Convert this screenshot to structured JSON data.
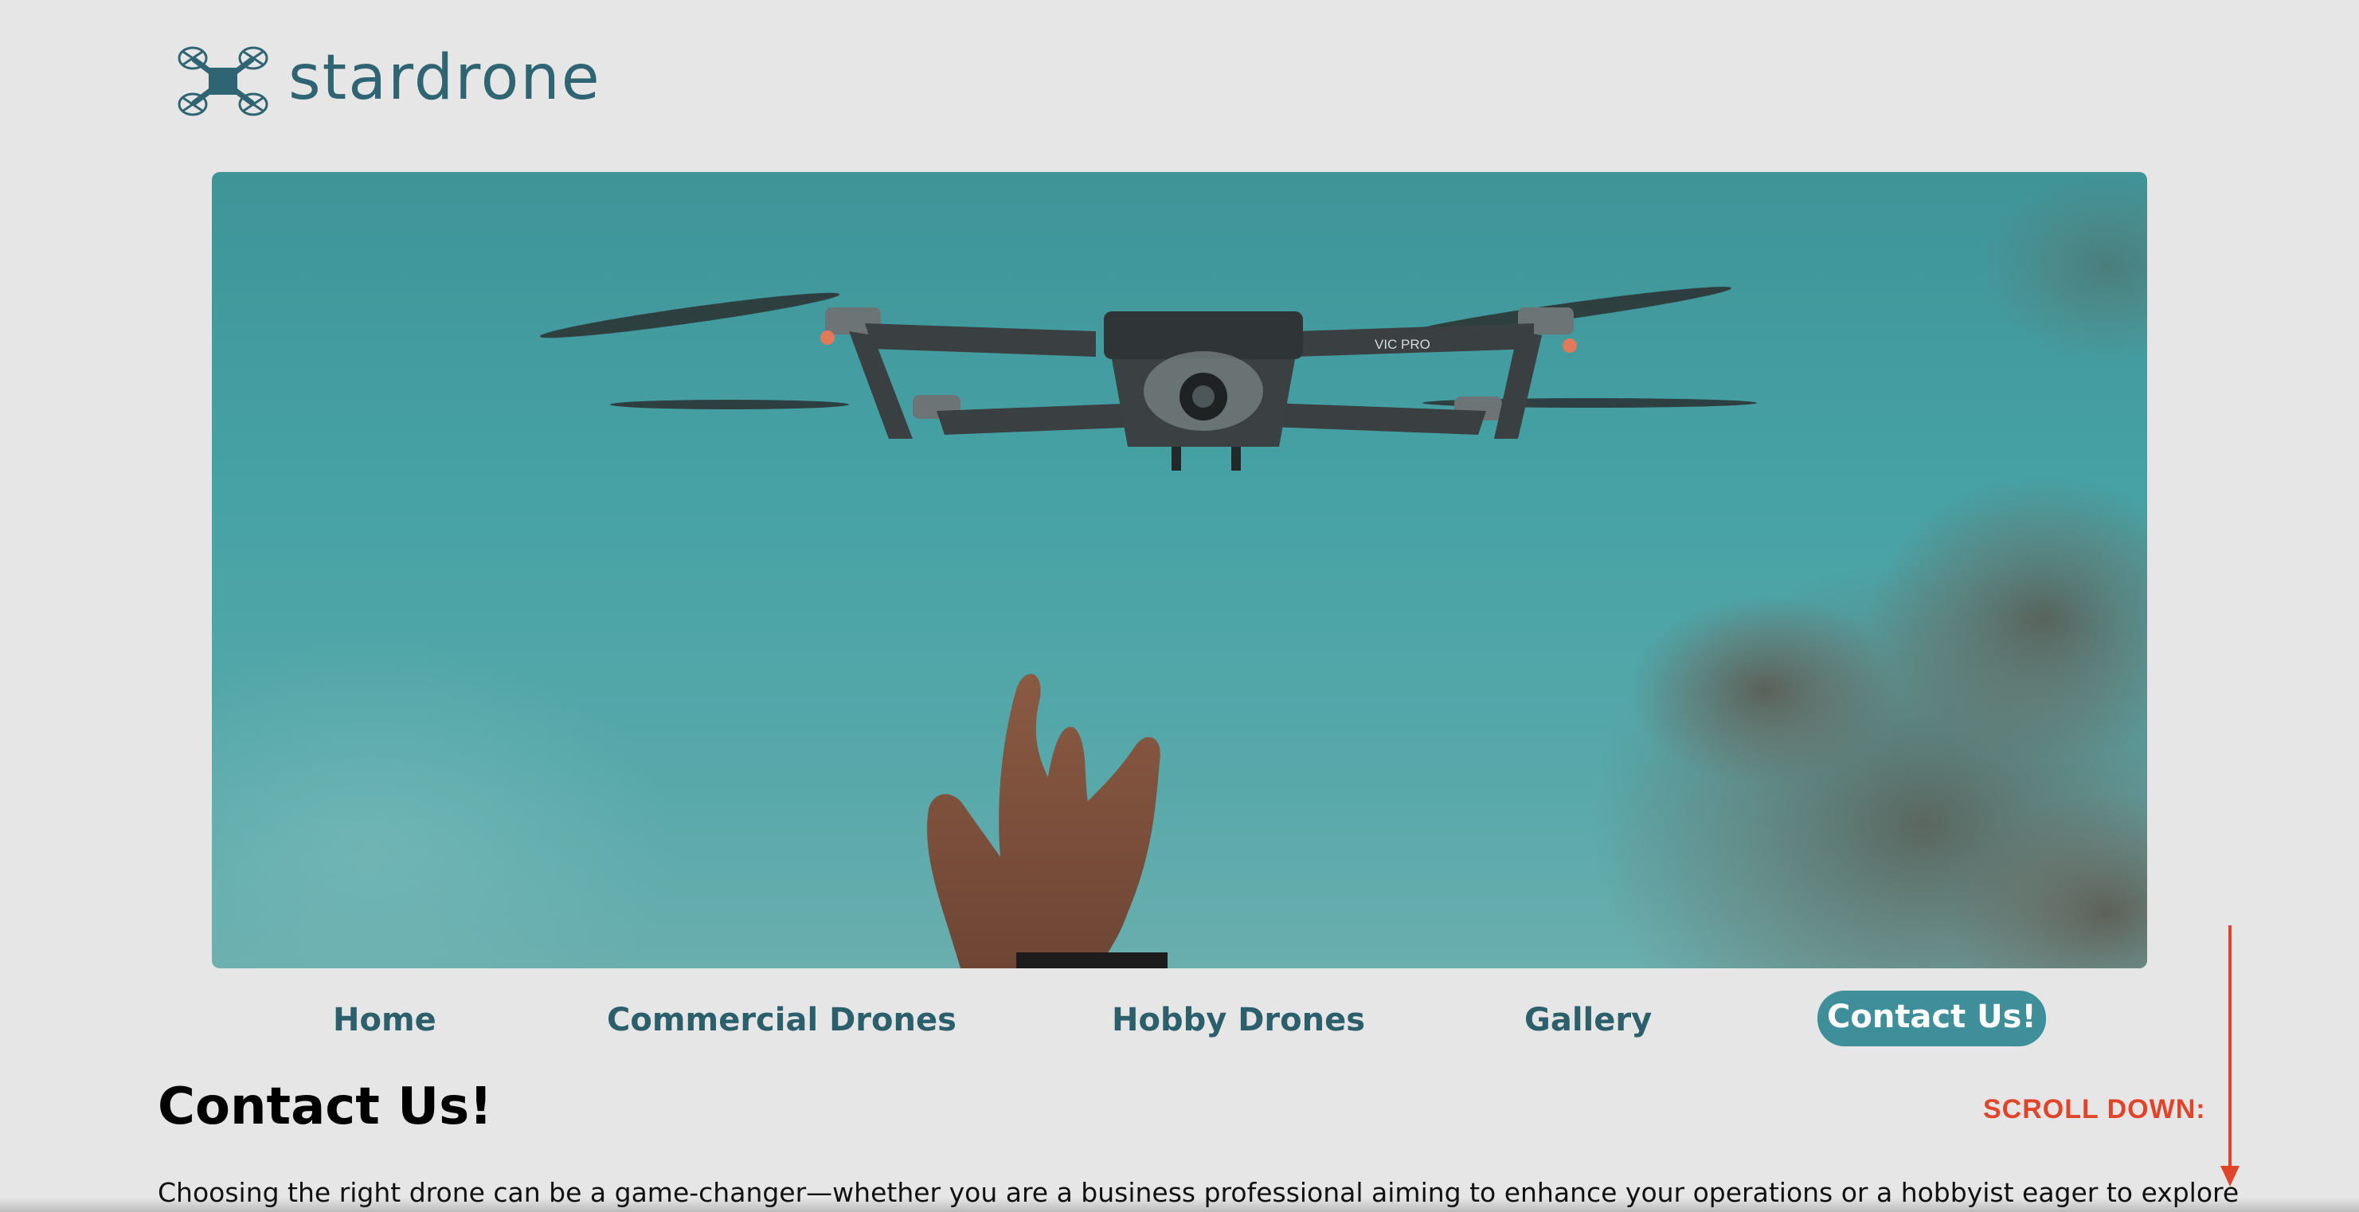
{
  "brand": {
    "name": "stardrone",
    "icon": "drone-logo-icon",
    "color": "#2f6572"
  },
  "hero": {
    "image": "drone-over-hand-photo",
    "drone_label": "VIC PRO"
  },
  "nav": {
    "items": [
      {
        "label": "Home",
        "active": false
      },
      {
        "label": "Commercial Drones",
        "active": false
      },
      {
        "label": "Hobby Drones",
        "active": false
      },
      {
        "label": "Gallery",
        "active": false
      },
      {
        "label": "Contact Us!",
        "active": true
      }
    ],
    "active_bg": "#3f8f9a"
  },
  "main": {
    "title": "Contact Us!",
    "intro": "Choosing the right drone can be a game-changer—whether you are a business professional aiming to enhance your operations or a hobbyist eager to explore"
  },
  "scroll_hint": {
    "label": "SCROLL DOWN:",
    "color": "#e0442b",
    "icon": "arrow-down-icon"
  }
}
